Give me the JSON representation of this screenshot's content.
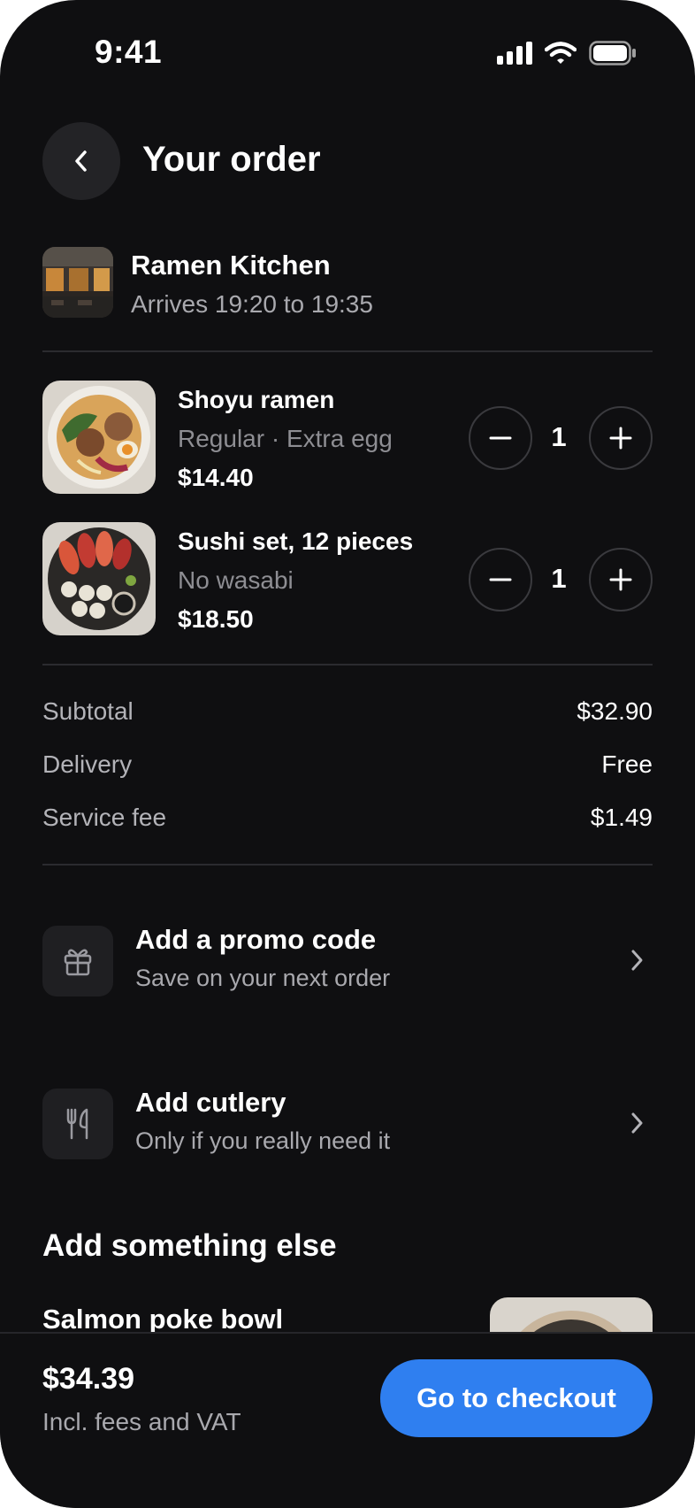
{
  "status_bar": {
    "time": "9:41"
  },
  "header": {
    "title": "Your order"
  },
  "restaurant": {
    "name": "Ramen Kitchen",
    "eta": "Arrives 19:20 to 19:35"
  },
  "items": [
    {
      "name": "Shoyu ramen",
      "note": "Regular · Extra egg",
      "price": "$14.40",
      "qty": "1"
    },
    {
      "name": "Sushi set, 12 pieces",
      "note": "No wasabi",
      "price": "$18.50",
      "qty": "1"
    }
  ],
  "summary": {
    "subtotal_label": "Subtotal",
    "subtotal_value": "$32.90",
    "delivery_label": "Delivery",
    "delivery_value": "Free",
    "service_label": "Service fee",
    "service_value": "$1.49"
  },
  "options": [
    {
      "title": "Add a promo code",
      "subtitle": "Save on your next order",
      "icon": "gift-icon"
    },
    {
      "title": "Add cutlery",
      "subtitle": "Only if you really need it",
      "icon": "cutlery-icon"
    }
  ],
  "suggestions": {
    "title": "Add something else",
    "first_item_name": "Salmon poke bowl"
  },
  "footer": {
    "total": "$34.39",
    "total_note": "Incl. fees and VAT",
    "checkout_label": "Go to checkout"
  },
  "colors": {
    "background": "#0f0f11",
    "accent": "#2f7ff0",
    "muted_text": "#8e8e93"
  }
}
